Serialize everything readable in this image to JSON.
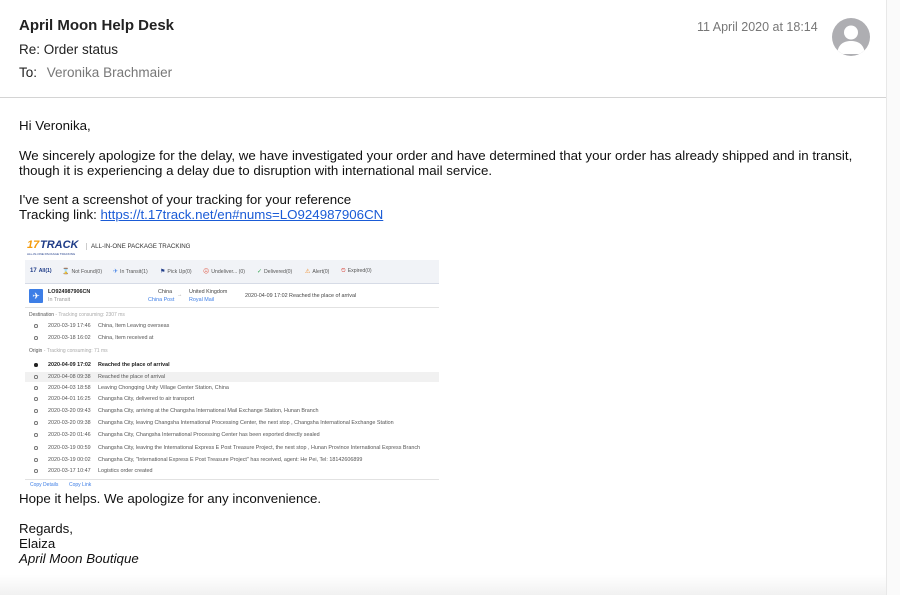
{
  "email": {
    "sender": "April Moon Help Desk",
    "subject": "Re: Order status",
    "to_label": "To:",
    "to_name": "Veronika Brachmaier",
    "date": "11 April 2020 at 18:14",
    "avatar_icon": "person-icon"
  },
  "body": {
    "greeting": "Hi Veronika,",
    "apology": "We sincerely apologize for the delay, we have investigated your order and have determined that your order has already shipped and in transit, though it is experiencing a delay due to disruption with international mail service.",
    "sent_line": "I've sent a screenshot of your tracking for your reference",
    "link_label": "Tracking link: ",
    "link_url": "https://t.17track.net/en#nums=LO924987906CN",
    "hope": "Hope it helps. We apologize for any inconvenience.",
    "regards": "Regards,",
    "name": "Elaiza",
    "shop": "April Moon Boutique"
  },
  "tracking": {
    "brand_17": "17",
    "brand_track": "TRACK",
    "brand_sub": "ALL-IN-ONE PACKAGE TRACKING",
    "tagline": "ALL-IN-ONE PACKAGE TRACKING",
    "tabs": [
      {
        "icon": "17",
        "label": "All(1)"
      },
      {
        "icon": "⌛",
        "label": "Not Found(0)"
      },
      {
        "icon": "✈",
        "label": "In Transit(1)"
      },
      {
        "icon": "⚑",
        "label": "Pick Up(0)"
      },
      {
        "icon": "☹",
        "label": "Undeliver... (0)"
      },
      {
        "icon": "✓",
        "label": "Delivered(0)"
      },
      {
        "icon": "⚠",
        "label": "Alert(0)"
      },
      {
        "icon": "⏲",
        "label": "Expired(0)"
      }
    ],
    "card": {
      "number": "LO924987906CN",
      "status": "In Transit",
      "origin": "China",
      "origin_carrier": "China Post",
      "arrow": "→",
      "dest": "United Kingdom",
      "dest_carrier": "Royal Mail",
      "latest": "2020-04-09 17:02  Reached the place of arrival"
    },
    "dest_section": "Destination",
    "dest_consuming": " - Tracking consuming: 2307 ms",
    "dest_events": [
      {
        "date": "2020-03-19 17:46",
        "text": "China, Item Leaving overseas"
      },
      {
        "date": "2020-03-18 16:02",
        "text": "China, Item received at"
      }
    ],
    "origin_section": "Origin",
    "origin_consuming": " - Tracking consuming: 71 ms",
    "origin_events": [
      {
        "date": "2020-04-09 17:02",
        "text": "Reached the place of arrival"
      },
      {
        "date": "2020-04-08 09:38",
        "text": "Reached the place of arrival"
      },
      {
        "date": "2020-04-03 18:58",
        "text": "Leaving Chongqing Unity Village Center Station, China"
      },
      {
        "date": "2020-04-01 16:25",
        "text": "Changsha City, delivered to air transport"
      },
      {
        "date": "2020-03-20 09:43",
        "text": "Changsha City, arriving at the Changsha International Mail Exchange Station, Hunan Branch"
      },
      {
        "date": "2020-03-20 09:38",
        "text": "Changsha City, leaving Changsha International Processing Center, the next stop , Changsha International Exchange Station"
      },
      {
        "date": "2020-03-20 01:46",
        "text": "Changsha City, Changsha International Processing Center has been exported directly sealed"
      },
      {
        "date": "2020-03-19 00:59",
        "text": "Changsha City, leaving the International Express E Post Treasure Project, the next stop , Hunan Province International Express Branch"
      },
      {
        "date": "2020-03-19 00:02",
        "text": "Changsha City, \"International Express E Post Treasure Project\" has received, agent: He Pei, Tel: 18142606899"
      },
      {
        "date": "2020-03-17 10:47",
        "text": "Logistics order created"
      }
    ],
    "copy_details": "Copy Details",
    "copy_link": "Copy Link"
  }
}
